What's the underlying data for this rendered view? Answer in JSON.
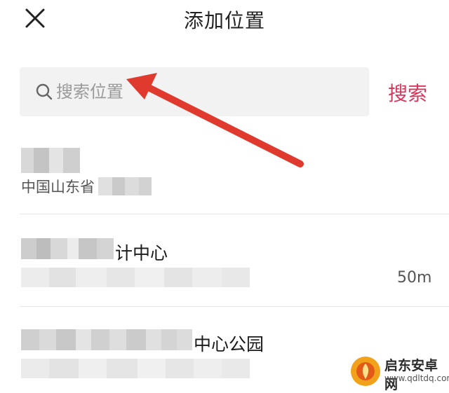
{
  "header": {
    "title": "添加位置"
  },
  "search": {
    "placeholder": "搜索位置",
    "button_label": "搜索"
  },
  "results": [
    {
      "name": "",
      "address": "中国山东省",
      "distance": ""
    },
    {
      "name": "计中心",
      "address": "",
      "distance": "50m"
    },
    {
      "name": "中心公园",
      "address": "",
      "distance": ""
    }
  ],
  "colors": {
    "accent": "#d6385c",
    "annotation_arrow": "#e03a2e"
  },
  "watermark": {
    "text": "启东安卓网",
    "url": "www.qdltdq.com"
  }
}
